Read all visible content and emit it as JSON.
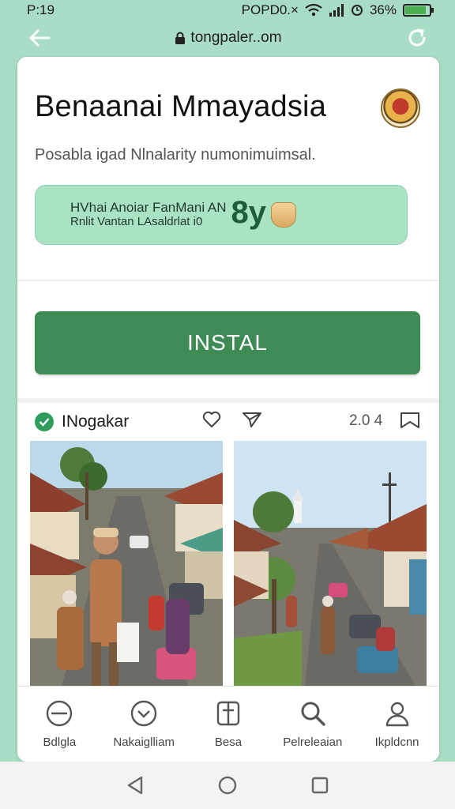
{
  "status_bar": {
    "time": "P:19",
    "right_text": "POPD0.×",
    "battery_text": "36%",
    "battery_level": 0.86,
    "icons": [
      "wifi-icon",
      "signal-icon",
      "alarm-icon",
      "battery-icon"
    ]
  },
  "browser": {
    "url": "tongpaler..om",
    "back_icon": "back-arrow-icon",
    "lock_icon": "lock-icon",
    "reload_icon": "reload-icon"
  },
  "app": {
    "title": "Benaanai Mmayadsia",
    "subtitle": "Posabla igad Nlnalarity numonimuimsal.",
    "logo_icon": "crest-logo"
  },
  "promo": {
    "line1": "HVhai Anoiar FanMani AN",
    "line2": "Rnlit Vantan LAsaldrlat i0",
    "number": "8y",
    "bag_icon": "money-bag-icon"
  },
  "install": {
    "label": "INSTAL"
  },
  "post": {
    "author": "INogakar",
    "count": "2.0 4",
    "icons": [
      "verified-icon",
      "heart-icon",
      "share-icon",
      "bookmark-icon"
    ]
  },
  "bottom_nav": [
    {
      "label": "Bdlgla",
      "icon": "minus-circle-icon"
    },
    {
      "label": "Nakaiglliam",
      "icon": "check-circle-icon"
    },
    {
      "label": "Besa",
      "icon": "book-icon"
    },
    {
      "label": "Pelreleaian",
      "icon": "search-icon"
    },
    {
      "label": "Ikpldcnn",
      "icon": "profile-icon"
    }
  ],
  "colors": {
    "header_bg": "#a9ddc5",
    "install_button": "#3f8b56",
    "promo_bg": "#a9e3c3"
  }
}
